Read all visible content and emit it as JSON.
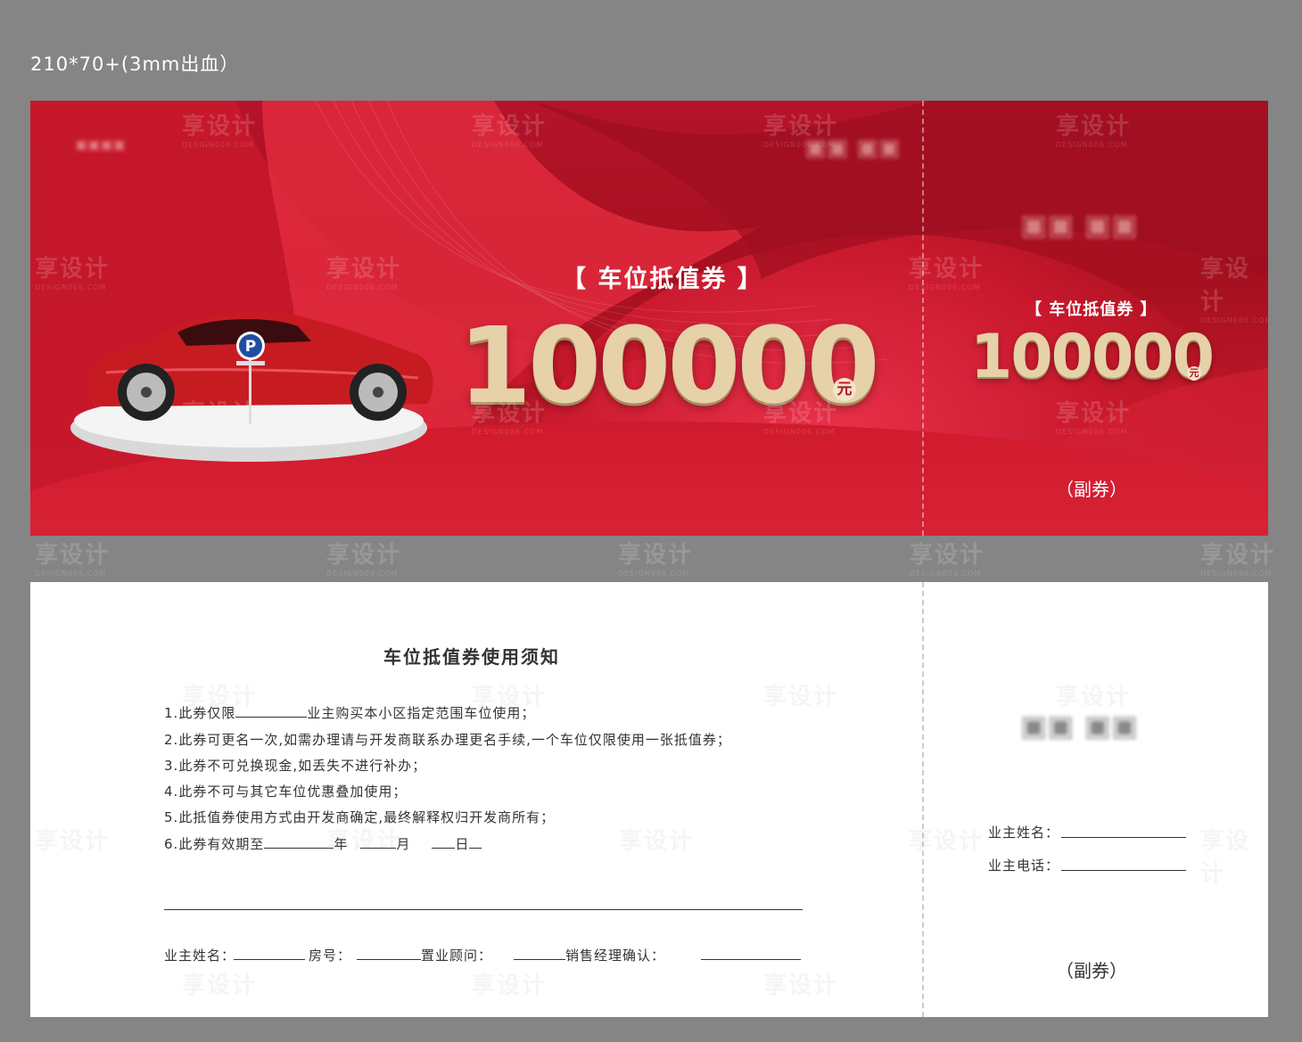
{
  "spec": "210*70+(3mm出血）",
  "watermark": {
    "text": "享设计",
    "sub": "DESIGN006.COM"
  },
  "front": {
    "title": "【 车位抵值券 】",
    "amount": "100000",
    "unit": "元",
    "stub_title": "【 车位抵值券 】",
    "stub_amount": "100000",
    "stub_unit": "元",
    "stub_subtitle": "（副券）"
  },
  "back": {
    "title": "车位抵值券使用须知",
    "rules": [
      {
        "num": "1.",
        "pre": "此券仅限",
        "post": "业主购买本小区指定范围车位使用；"
      },
      {
        "num": "2.",
        "text": "此券可更名一次,如需办理请与开发商联系办理更名手续,一个车位仅限使用一张抵值券；"
      },
      {
        "num": "3.",
        "text": "此券不可兑换现金,如丢失不进行补办；"
      },
      {
        "num": "4.",
        "text": "此券不可与其它车位优惠叠加使用；"
      },
      {
        "num": "5.",
        "text": "此抵值券使用方式由开发商确定,最终解释权归开发商所有；"
      },
      {
        "num": "6.",
        "pre": "此券有效期至",
        "year": "年",
        "month": "月",
        "day": "日"
      }
    ],
    "signatures": {
      "owner_name": "业主姓名：",
      "room": "房号：",
      "consultant": "置业顾问：",
      "manager": "销售经理确认："
    },
    "stub": {
      "owner_name": "业主姓名：",
      "owner_phone": "业主电话：",
      "subtitle": "（副券）"
    }
  }
}
